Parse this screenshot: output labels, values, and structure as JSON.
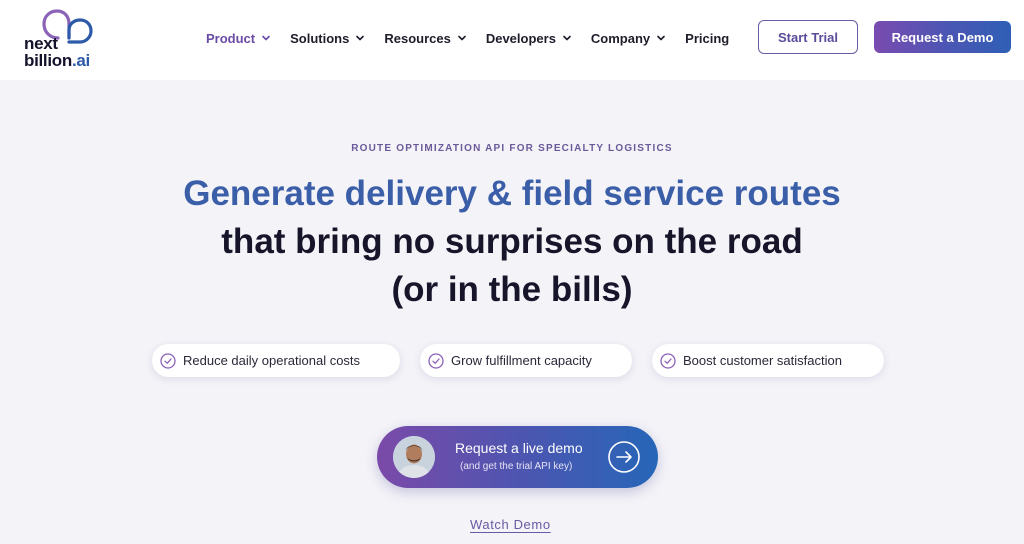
{
  "header": {
    "logo": {
      "line1": "next",
      "line2": "billion",
      "suffix": ".ai"
    },
    "nav": [
      {
        "label": "Product",
        "has_dropdown": true,
        "active": true
      },
      {
        "label": "Solutions",
        "has_dropdown": true,
        "active": false
      },
      {
        "label": "Resources",
        "has_dropdown": true,
        "active": false
      },
      {
        "label": "Developers",
        "has_dropdown": true,
        "active": false
      },
      {
        "label": "Company",
        "has_dropdown": true,
        "active": false
      },
      {
        "label": "Pricing",
        "has_dropdown": false,
        "active": false
      }
    ],
    "start_trial_label": "Start Trial",
    "request_demo_label": "Request a Demo"
  },
  "hero": {
    "eyebrow": "ROUTE OPTIMIZATION API FOR SPECIALTY LOGISTICS",
    "headline_line1": "Generate delivery & field service routes",
    "headline_line2": "that bring no surprises on the road",
    "headline_line3": "(or in the bills)",
    "benefits": [
      "Reduce daily operational costs",
      "Grow fulfillment capacity",
      "Boost customer satisfaction"
    ],
    "cta": {
      "title": "Request a live demo",
      "subtitle": "(and get the trial API key)"
    },
    "watch_demo_label": "Watch Demo"
  },
  "colors": {
    "accent_purple": "#6a4ba5",
    "headline_blue": "#3b5ea8",
    "gradient_start": "#7b4aa8",
    "gradient_end": "#2666b8",
    "background": "#f4f3f8"
  },
  "icons": {
    "benefit": "check-circle-icon",
    "cta": "arrow-right-circle-icon",
    "nav_dropdown": "chevron-down-icon"
  }
}
